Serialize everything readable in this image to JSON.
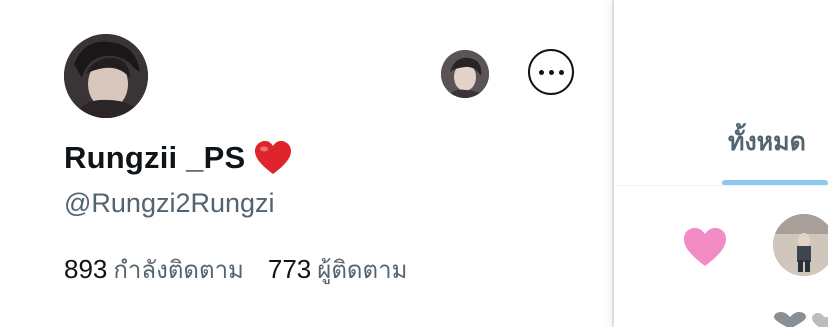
{
  "profile": {
    "display_name": "Rungzii _PS",
    "name_emoji": "red-heart-icon",
    "handle": "@Rungzi2Rungzi",
    "following_count": "893",
    "following_label": "กำลังติดตาม",
    "followers_count": "773",
    "followers_label": "ผู้ติดตาม"
  },
  "side_panel": {
    "tab_label": "ทั้งหมด",
    "reaction_icon": "pink-heart-icon"
  },
  "colors": {
    "text_primary": "#0f1419",
    "text_secondary": "#536471",
    "tab_underline": "#8ec8f0",
    "heart_red": "#e0242c",
    "heart_pink": "#f28ac3"
  }
}
